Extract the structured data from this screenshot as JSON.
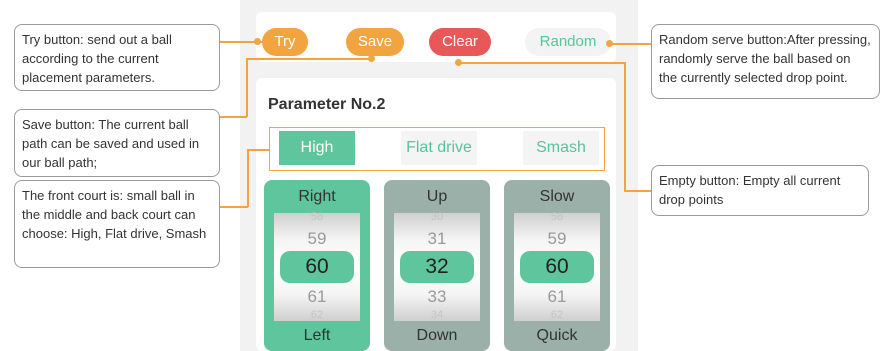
{
  "toolbar": {
    "try_label": "Try",
    "save_label": "Save",
    "clear_label": "Clear",
    "random_label": "Random"
  },
  "parameter": {
    "title": "Parameter No.2",
    "options": [
      "High",
      "Flat drive",
      "Smash"
    ],
    "selected_option": "High"
  },
  "pickers": [
    {
      "top_label": "Right",
      "bottom_label": "Left",
      "values": [
        "58",
        "59",
        "60",
        "61",
        "62"
      ],
      "selected": "60"
    },
    {
      "top_label": "Up",
      "bottom_label": "Down",
      "values": [
        "30",
        "31",
        "32",
        "33",
        "34"
      ],
      "selected": "32"
    },
    {
      "top_label": "Slow",
      "bottom_label": "Quick",
      "values": [
        "58",
        "59",
        "60",
        "61",
        "62"
      ],
      "selected": "60"
    }
  ],
  "callouts": {
    "try": "Try button: send out a ball according to the current placement parameters.",
    "save": "Save button: The current ball path can be saved and used in our ball path;",
    "court": "The front court is: small ball in the middle and back court can choose: High, Flat drive, Smash",
    "random": "Random serve button:After pressing, randomly serve the ball based on the currently selected drop point.",
    "empty": "Empty button: Empty all current drop points"
  },
  "colors": {
    "accent_green": "#5ec59d",
    "orange": "#f2a441",
    "red": "#e85858",
    "muted_green": "#9ab0a8"
  }
}
